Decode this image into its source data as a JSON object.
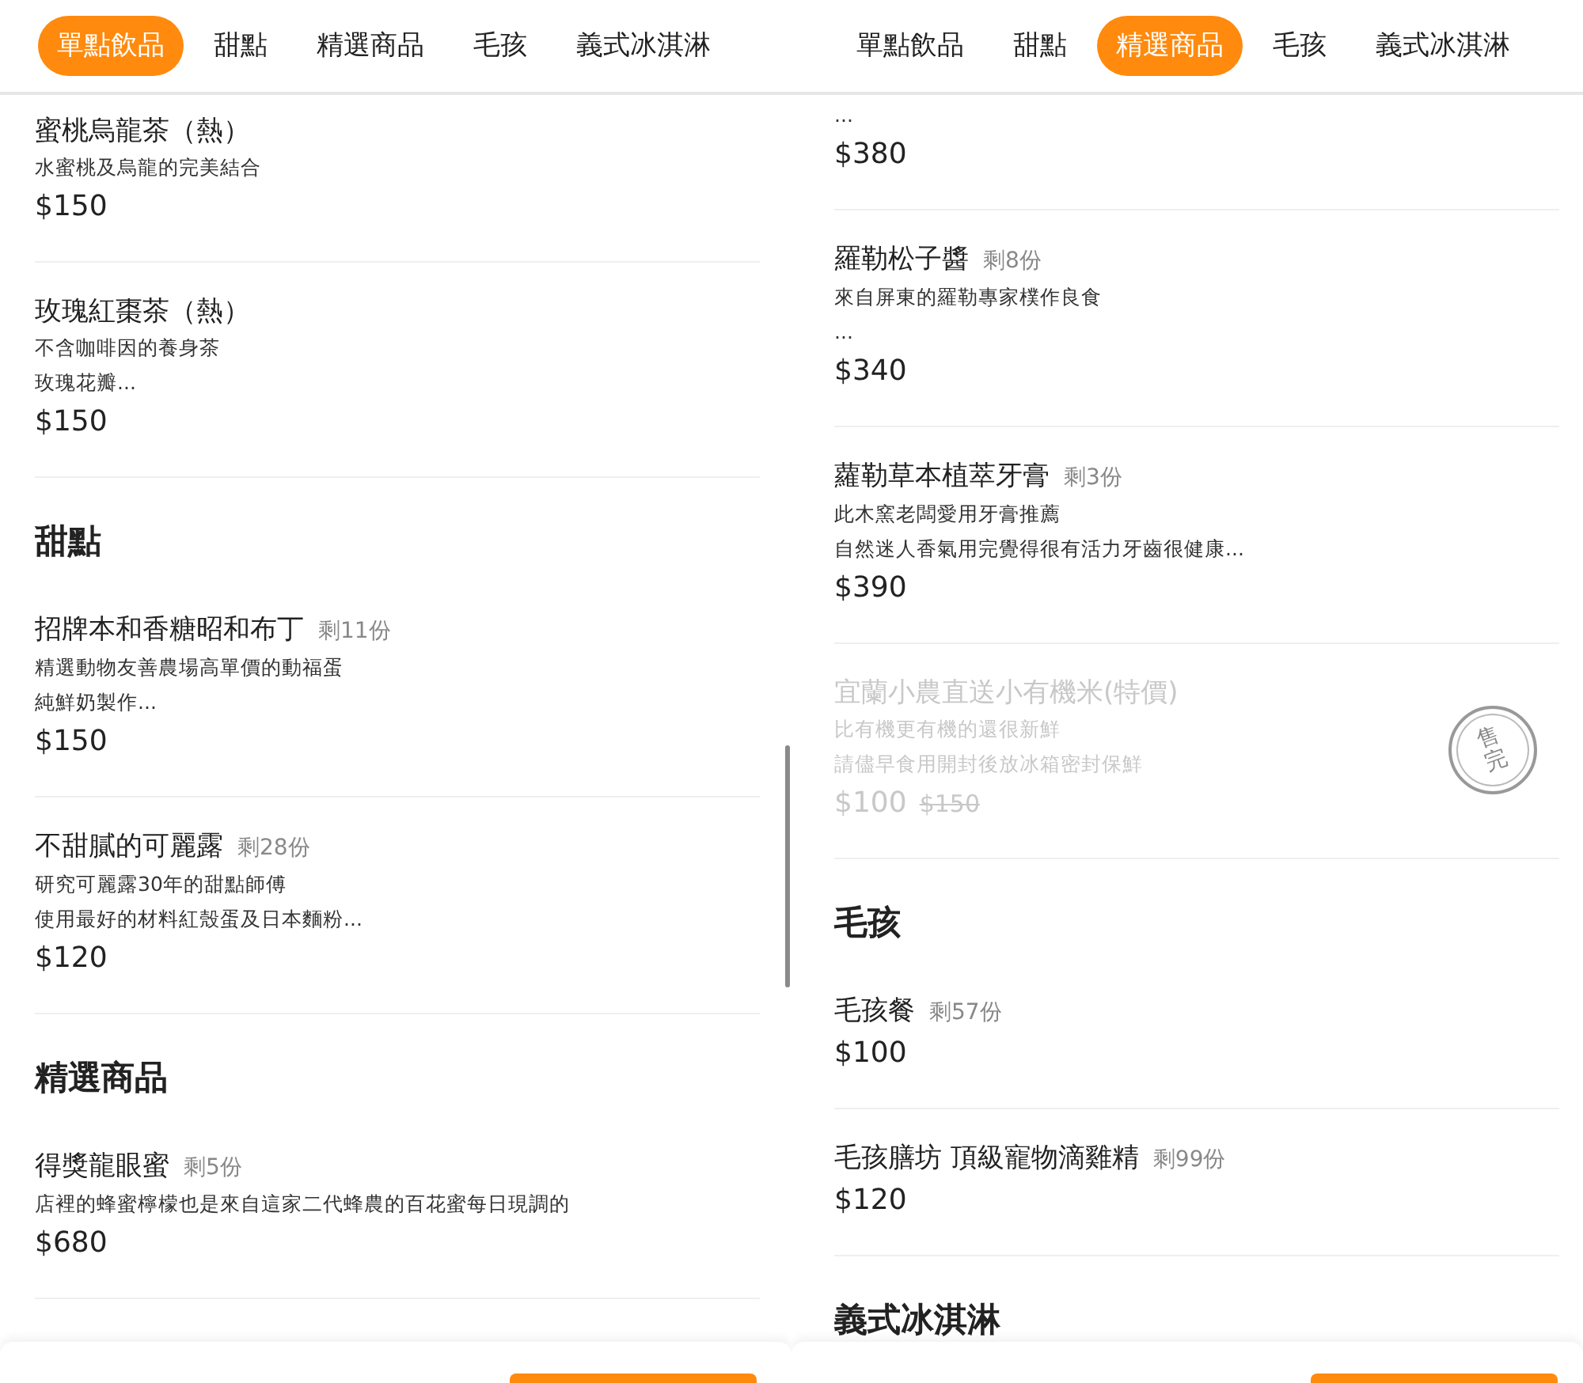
{
  "panels": [
    {
      "tabs": [
        {
          "label": "單點飲品",
          "selected": true
        },
        {
          "label": "甜點",
          "selected": false
        },
        {
          "label": "精選商品",
          "selected": false
        },
        {
          "label": "毛孩",
          "selected": false
        },
        {
          "label": "義式冰淇淋",
          "selected": false
        }
      ],
      "rows": [
        {
          "kind": "item",
          "name": "蜜桃烏龍茶（熱）",
          "description": [
            "水蜜桃及烏龍的完美結合"
          ],
          "price": "$150",
          "sold_out": false
        },
        {
          "kind": "item",
          "name": "玫瑰紅棗茶（熱）",
          "description": [
            "不含咖啡因的養身茶",
            "玫瑰花瓣..."
          ],
          "price": "$150",
          "sold_out": false
        },
        {
          "kind": "heading",
          "title": "甜點"
        },
        {
          "kind": "item",
          "name": "招牌本和香糖昭和布丁",
          "stock": "剩11份",
          "description": [
            "精選動物友善農場高單價的動福蛋",
            "純鮮奶製作..."
          ],
          "price": "$150",
          "sold_out": false
        },
        {
          "kind": "item",
          "name": "不甜膩的可麗露",
          "stock": "剩28份",
          "description": [
            "研究可麗露30年的甜點師傅",
            "使用最好的材料紅殼蛋及日本麵粉..."
          ],
          "price": "$120",
          "sold_out": false
        },
        {
          "kind": "heading",
          "title": "精選商品"
        },
        {
          "kind": "item",
          "name": "得獎龍眼蜜",
          "stock": "剩5份",
          "description": [
            "店裡的蜂蜜檸檬也是來自這家二代蜂農的百花蜜每日現調的"
          ],
          "price": "$680",
          "sold_out": false
        }
      ]
    },
    {
      "tabs": [
        {
          "label": "單點飲品",
          "selected": false
        },
        {
          "label": "甜點",
          "selected": false
        },
        {
          "label": "精選商品",
          "selected": true
        },
        {
          "label": "毛孩",
          "selected": false
        },
        {
          "label": "義式冰淇淋",
          "selected": false
        }
      ],
      "rows": [
        {
          "kind": "item",
          "description": [
            "..."
          ],
          "price": "$380",
          "sold_out": false
        },
        {
          "kind": "item",
          "name": "羅勒松子醬",
          "stock": "剩8份",
          "description": [
            "來自屏東的羅勒專家樸作良食",
            "..."
          ],
          "price": "$340",
          "sold_out": false
        },
        {
          "kind": "item",
          "name": "蘿勒草本植萃牙膏",
          "stock": "剩3份",
          "description": [
            "此木窯老闆愛用牙膏推薦",
            "自然迷人香氣用完覺得很有活力牙齒很健康..."
          ],
          "price": "$390",
          "sold_out": false
        },
        {
          "kind": "item",
          "name": "宜蘭小農直送小有機米(特價)",
          "description": [
            "比有機更有機的還很新鮮",
            "請儘早食用開封後放冰箱密封保鮮"
          ],
          "price": "$100",
          "original_price": "$150",
          "sold_out": true,
          "sold_out_label": "售完"
        },
        {
          "kind": "heading",
          "title": "毛孩"
        },
        {
          "kind": "item",
          "name": "毛孩餐",
          "stock": "剩57份",
          "price": "$100",
          "sold_out": false
        },
        {
          "kind": "item",
          "name": "毛孩膳坊 頂級寵物滴雞精",
          "stock": "剩99份",
          "price": "$120",
          "sold_out": false
        },
        {
          "kind": "heading",
          "title": "義式冰淇淋"
        }
      ]
    }
  ]
}
